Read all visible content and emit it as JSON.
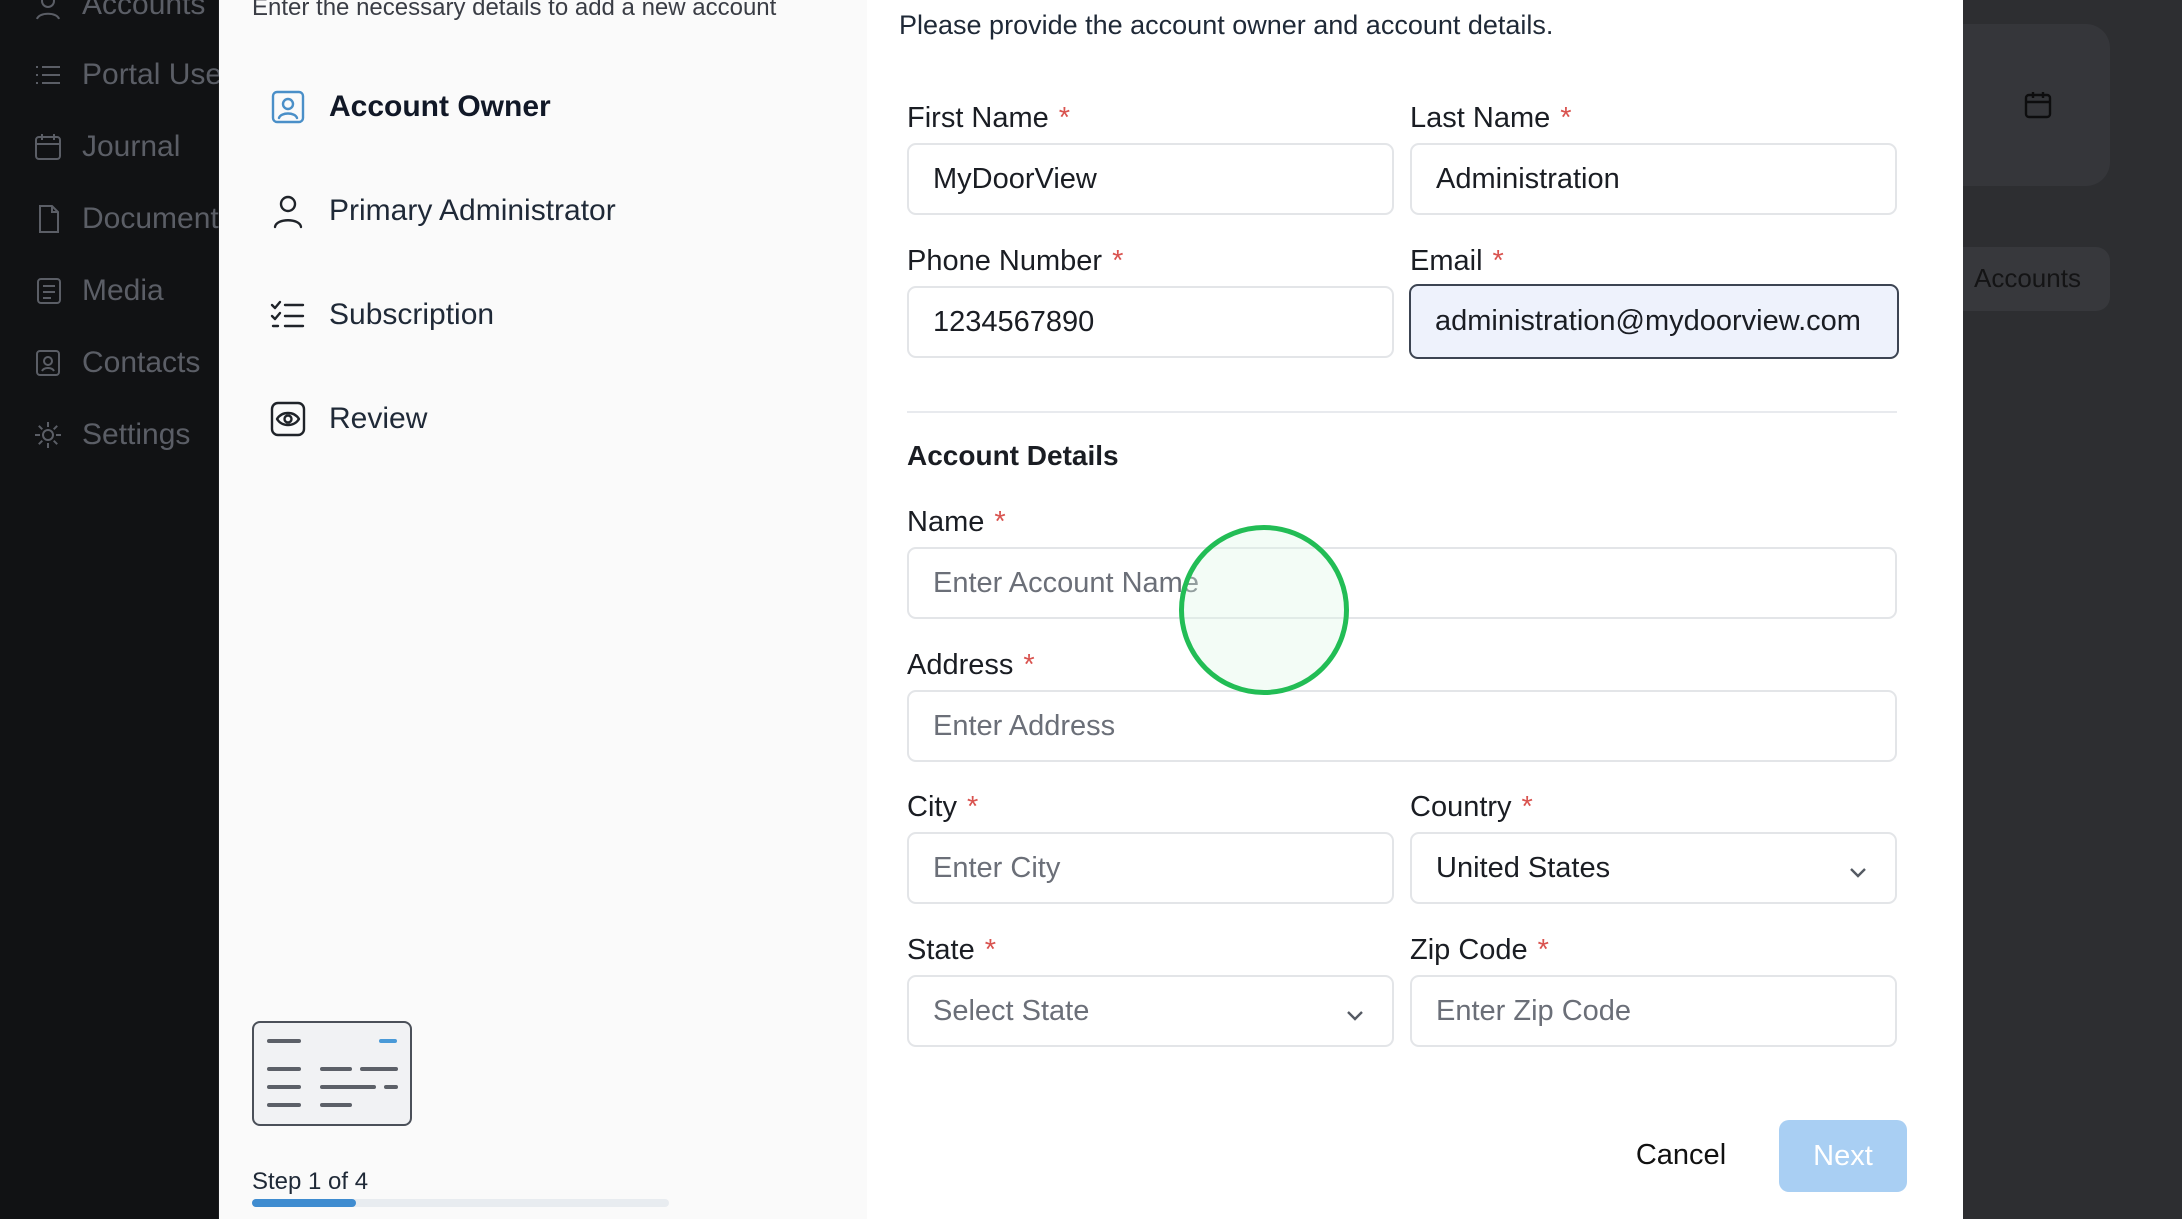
{
  "background": {
    "nav_items": [
      {
        "label": "Accounts",
        "icon": "user-circle-icon"
      },
      {
        "label": "Portal Users",
        "icon": "list-icon"
      },
      {
        "label": "Journal",
        "icon": "calendar-icon"
      },
      {
        "label": "Documents",
        "icon": "document-icon"
      },
      {
        "label": "Media",
        "icon": "media-icon"
      },
      {
        "label": "Contacts",
        "icon": "contact-icon"
      },
      {
        "label": "Settings",
        "icon": "gear-icon"
      }
    ],
    "right_pill_label": "Accounts"
  },
  "stepper": {
    "subtitle": "Enter the necessary details to add a new account",
    "steps": [
      {
        "label": "Account Owner",
        "icon": "account-owner-icon",
        "active": true
      },
      {
        "label": "Primary Administrator",
        "icon": "person-icon",
        "active": false
      },
      {
        "label": "Subscription",
        "icon": "checklist-icon",
        "active": false
      },
      {
        "label": "Review",
        "icon": "eye-icon",
        "active": false
      }
    ],
    "step_count": "Step 1 of 4",
    "progress": 0.25
  },
  "form": {
    "description": "Please provide the account owner and account details.",
    "required_marker": "*",
    "owner": {
      "first_name": {
        "label": "First Name",
        "value": "MyDoorView"
      },
      "last_name": {
        "label": "Last Name",
        "value": "Administration"
      },
      "phone": {
        "label": "Phone Number",
        "value": "1234567890"
      },
      "email": {
        "label": "Email",
        "value": "administration@mydoorview.com"
      }
    },
    "account_details_title": "Account Details",
    "account": {
      "name": {
        "label": "Name",
        "placeholder": "Enter Account Name"
      },
      "address": {
        "label": "Address",
        "placeholder": "Enter Address"
      },
      "city": {
        "label": "City",
        "placeholder": "Enter City"
      },
      "country": {
        "label": "Country",
        "value": "United States"
      },
      "state": {
        "label": "State",
        "placeholder": "Select State"
      },
      "zip": {
        "label": "Zip Code",
        "placeholder": "Enter Zip Code"
      }
    },
    "cancel_label": "Cancel",
    "next_label": "Next"
  },
  "colors": {
    "accent": "#3f8cd0",
    "required": "#d9534f",
    "next_disabled": "#a9cff3",
    "cursor": "#22bd55"
  }
}
